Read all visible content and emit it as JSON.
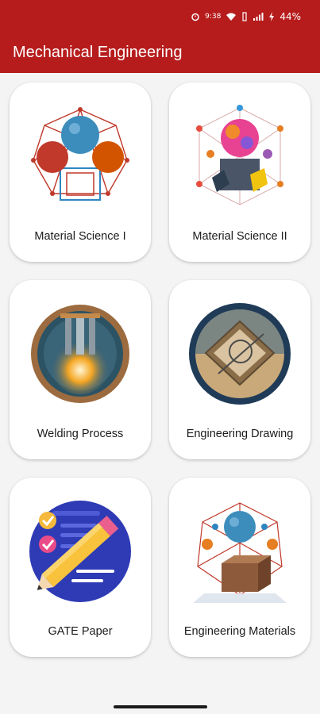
{
  "status": {
    "time": "9:38",
    "battery": "44%"
  },
  "appbar": {
    "title": "Mechanical Engineering"
  },
  "cards": [
    {
      "label": "Material Science I",
      "icon": "molecule-lattice-icon"
    },
    {
      "label": "Material Science II",
      "icon": "crystal-lattice-icon"
    },
    {
      "label": "Welding Process",
      "icon": "welding-icon"
    },
    {
      "label": "Engineering Drawing",
      "icon": "drafting-tools-icon"
    },
    {
      "label": "GATE Paper",
      "icon": "pencil-checklist-icon"
    },
    {
      "label": "Engineering Materials",
      "icon": "materials-structure-icon"
    }
  ],
  "colors": {
    "primary": "#b71c1c",
    "background": "#f4f4f4",
    "card": "#ffffff"
  }
}
